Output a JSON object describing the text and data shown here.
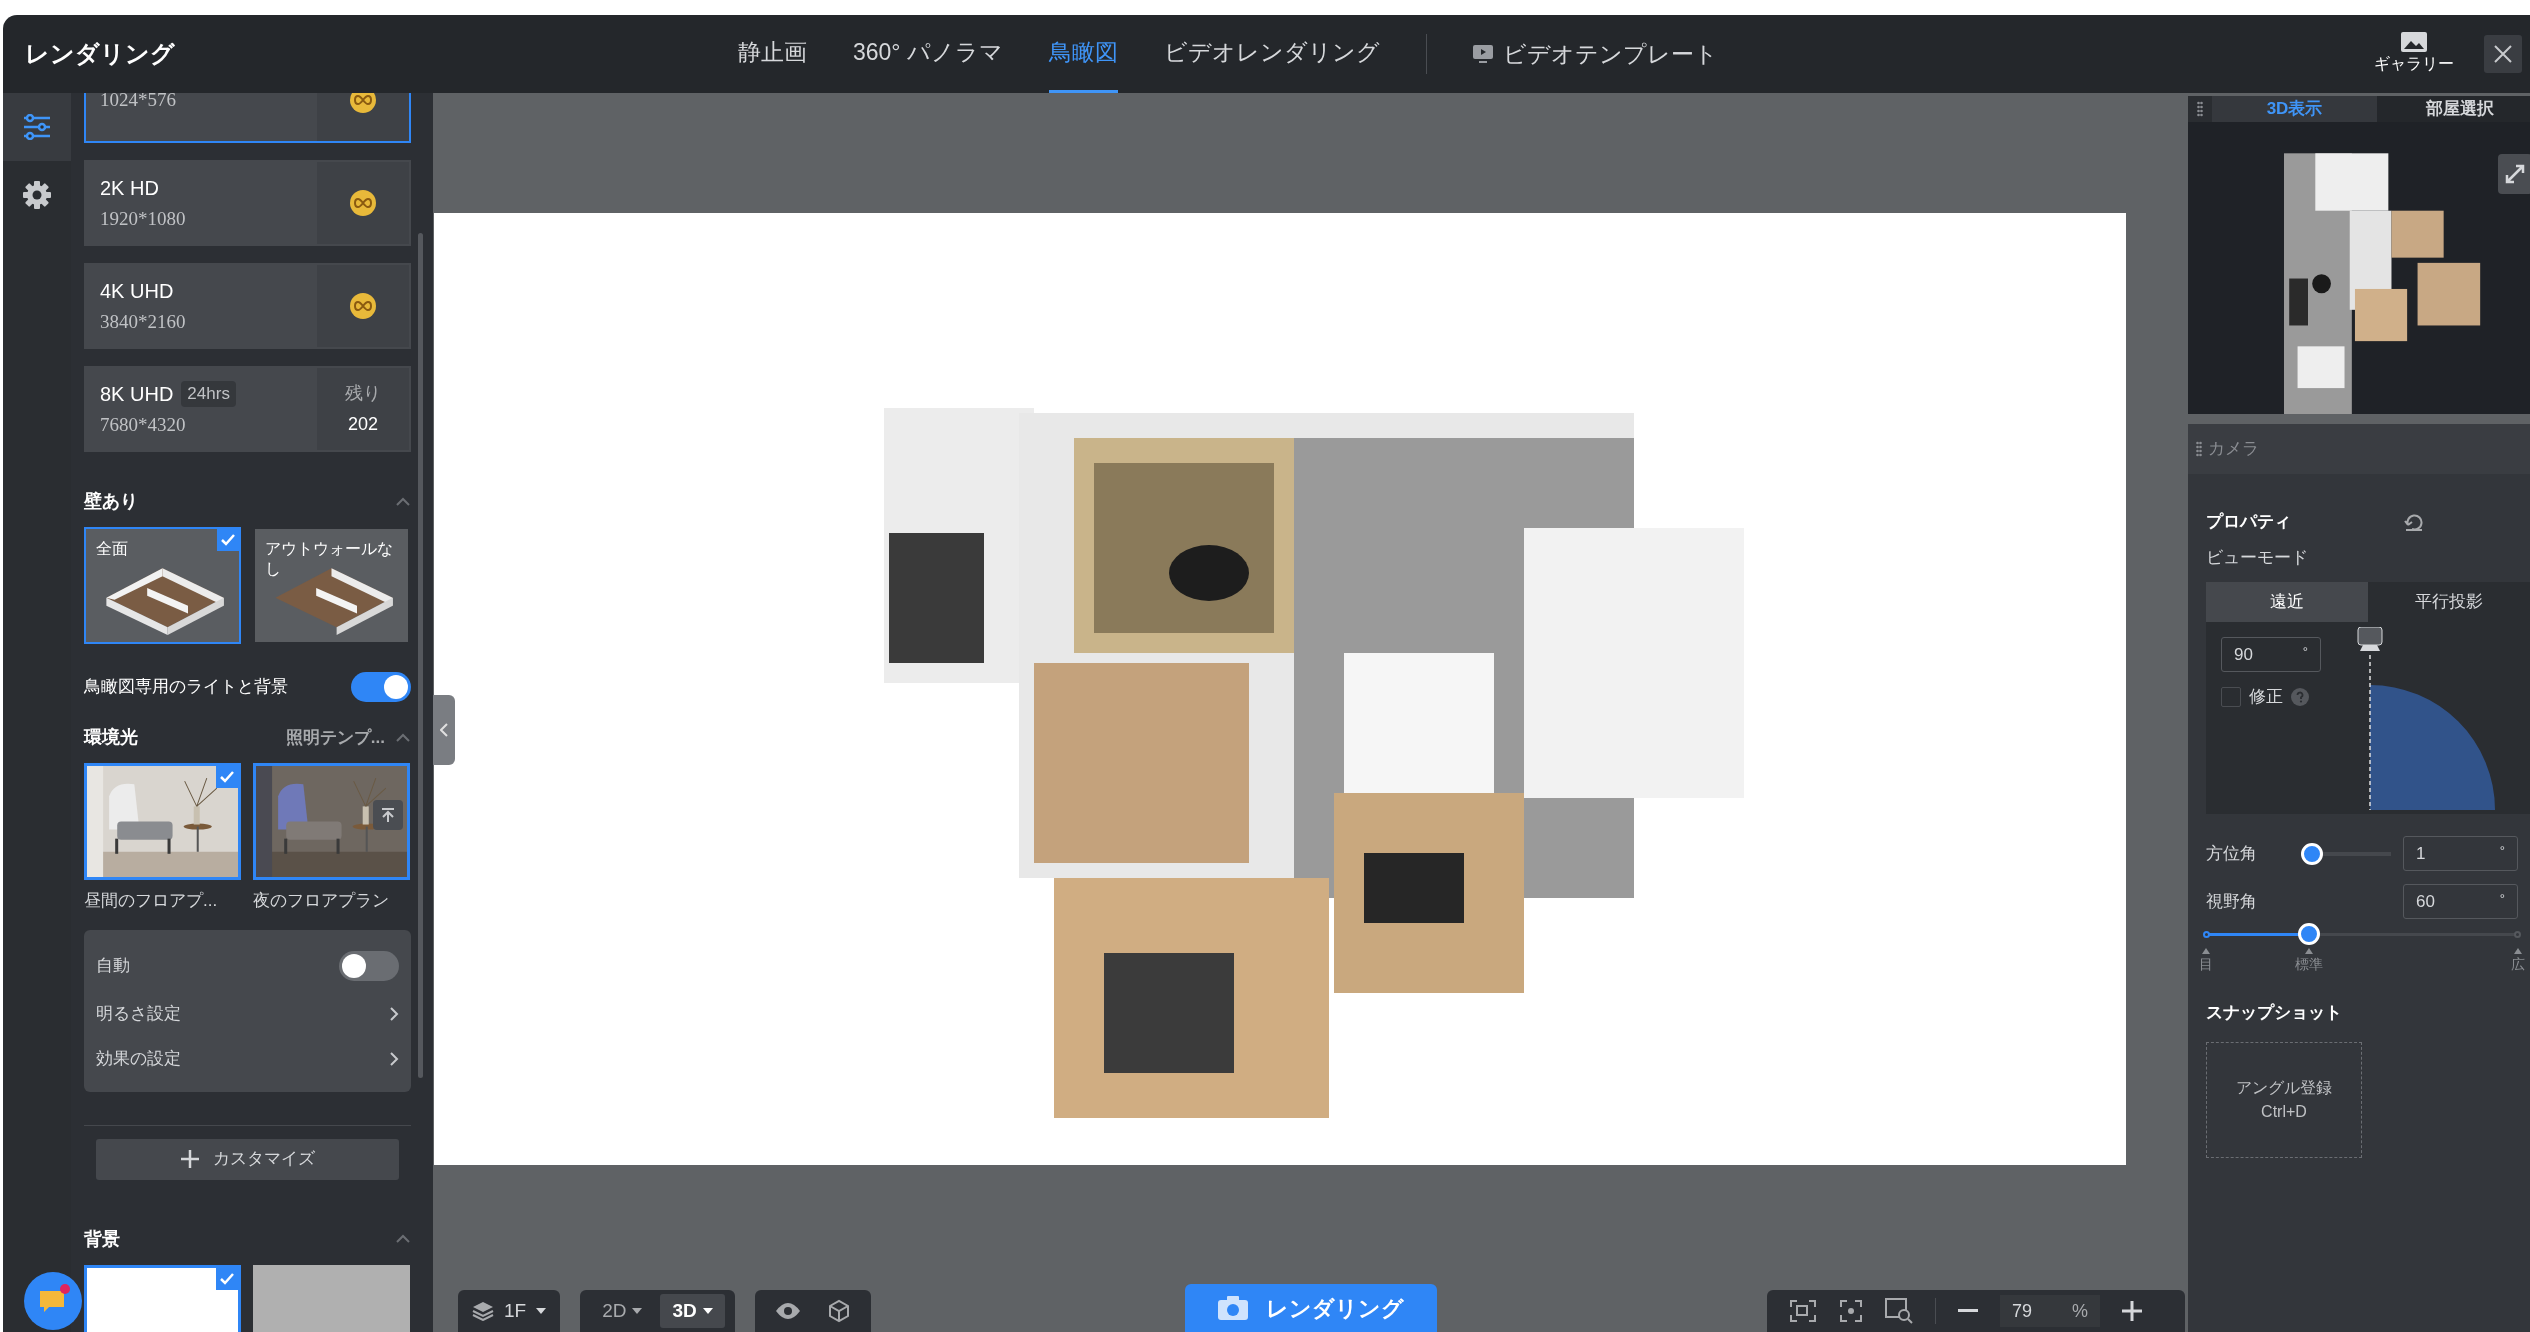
{
  "app_title": "レンダリング",
  "mode_tabs": [
    {
      "label": "静止画",
      "selected": false
    },
    {
      "label": "360° パノラマ",
      "selected": false
    },
    {
      "label": "鳥瞰図",
      "selected": true
    },
    {
      "label": "ビデオレンダリング",
      "selected": false
    }
  ],
  "video_template": "ビデオテンプレート",
  "gallery": "ギャラリー",
  "side_rail": [
    {
      "kind": "sliders",
      "selected": true
    },
    {
      "kind": "gear",
      "selected": false
    }
  ],
  "resolutions": [
    {
      "kind": "coin",
      "size": "1024*576",
      "selected": true
    },
    {
      "kind": "coin",
      "name": "2K HD",
      "size": "1920*1080",
      "selected": false
    },
    {
      "kind": "coin",
      "name": "4K UHD",
      "size": "3840*2160",
      "selected": false
    },
    {
      "kind": "quota",
      "name": "8K UHD",
      "badge": "24hrs",
      "size": "7680*4320",
      "remaining_label": "残り",
      "remaining": "202",
      "selected": false
    }
  ],
  "walls": {
    "title": "壁あり",
    "options": [
      {
        "label": "全面",
        "selected": true
      },
      {
        "label": "アウトウォールなし",
        "selected": false
      }
    ]
  },
  "birdseye_light": {
    "label": "鳥瞰図専用のライトと背景",
    "on": true
  },
  "ambient": {
    "title": "環境光",
    "template_link": "照明テンプ...",
    "presets": [
      {
        "label": "昼間のフロアプ...",
        "selected": true,
        "hovered": false
      },
      {
        "label": "夜のフロアプラン",
        "selected": false,
        "hovered": true
      }
    ],
    "auto": {
      "label": "自動",
      "on": false
    },
    "settings": [
      "明るさ設定",
      "効果の設定"
    ],
    "customize": "カスタマイズ"
  },
  "background": {
    "title": "背景",
    "options": [
      {
        "kind": "white",
        "selected": true
      },
      {
        "kind": "gray",
        "selected": false
      }
    ]
  },
  "chat": {
    "notification": true
  },
  "minimap": {
    "tabs": [
      {
        "label": "3D表示",
        "selected": true
      },
      {
        "label": "部屋選択",
        "selected": false
      }
    ]
  },
  "camera": {
    "title": "カメラ",
    "properties": "プロパティ",
    "view_mode_label": "ビューモード",
    "view_modes": [
      {
        "label": "遠近",
        "selected": true
      },
      {
        "label": "平行投影",
        "selected": false
      }
    ],
    "pitch": "90",
    "pitch_unit": "°",
    "correction": {
      "label": "修正",
      "checked": false
    },
    "azimuth": {
      "label": "方位角",
      "value": "1",
      "unit": "°",
      "level": 0
    },
    "fov": {
      "label": "視野角",
      "value": "60",
      "unit": "°",
      "level": 0.33,
      "marks": [
        "目",
        "標準",
        "広"
      ]
    }
  },
  "snapshot": {
    "title": "スナップショット",
    "add_label": "アングル登録",
    "shortcut": "Ctrl+D"
  },
  "bottom": {
    "floor": "1F",
    "views": [
      {
        "label": "2D",
        "selected": false
      },
      {
        "label": "3D",
        "selected": true
      }
    ],
    "render_button": "レンダリング",
    "zoom": "79",
    "zoom_unit": "%"
  }
}
